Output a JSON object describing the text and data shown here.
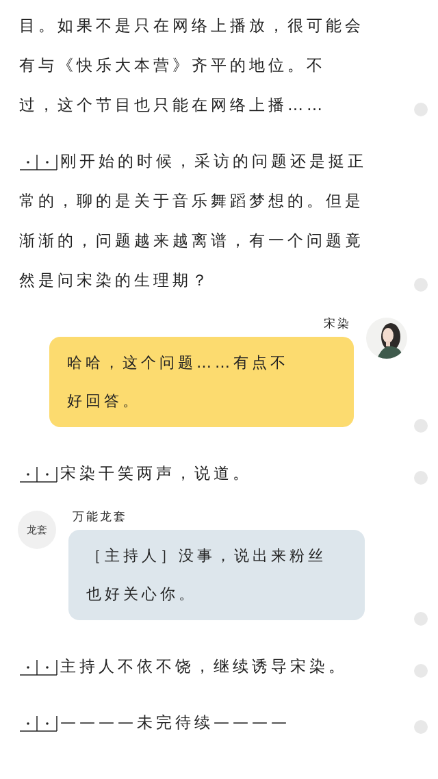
{
  "blocks": [
    {
      "kind": "paragraph",
      "indent": false,
      "lines": [
        "目。如果不是只在网络上播放，很可能会",
        "有与《快乐大本营》齐平的地位。不",
        "过，这个节目也只能在网络上播……"
      ]
    },
    {
      "kind": "paragraph",
      "indent": true,
      "lines": [
        "刚开始的时候，采访的问题还是挺正",
        "常的，聊的是关于音乐舞蹈梦想的。但是",
        "渐渐的，问题越来越离谱，有一个问题竟",
        "然是问宋染的生理期？"
      ]
    },
    {
      "kind": "sent",
      "speaker": "宋染",
      "avatar": {
        "kind": "picture"
      },
      "color": "#fcdb6f",
      "lines": [
        "哈哈，这个问题……有点不",
        "好回答。"
      ]
    },
    {
      "kind": "paragraph",
      "indent": true,
      "lines": [
        "宋染干笑两声，说道。"
      ]
    },
    {
      "kind": "received",
      "speaker": "万能龙套",
      "avatar": {
        "kind": "text",
        "label": "龙套"
      },
      "color": "#dde6ec",
      "lines": [
        "［主持人］没事，说出来粉丝",
        "也好关心你。"
      ]
    },
    {
      "kind": "paragraph",
      "indent": true,
      "lines": [
        "主持人不依不饶，继续诱导宋染。"
      ]
    },
    {
      "kind": "paragraph",
      "indent": true,
      "lines": [
        "————未完待续————"
      ]
    }
  ]
}
